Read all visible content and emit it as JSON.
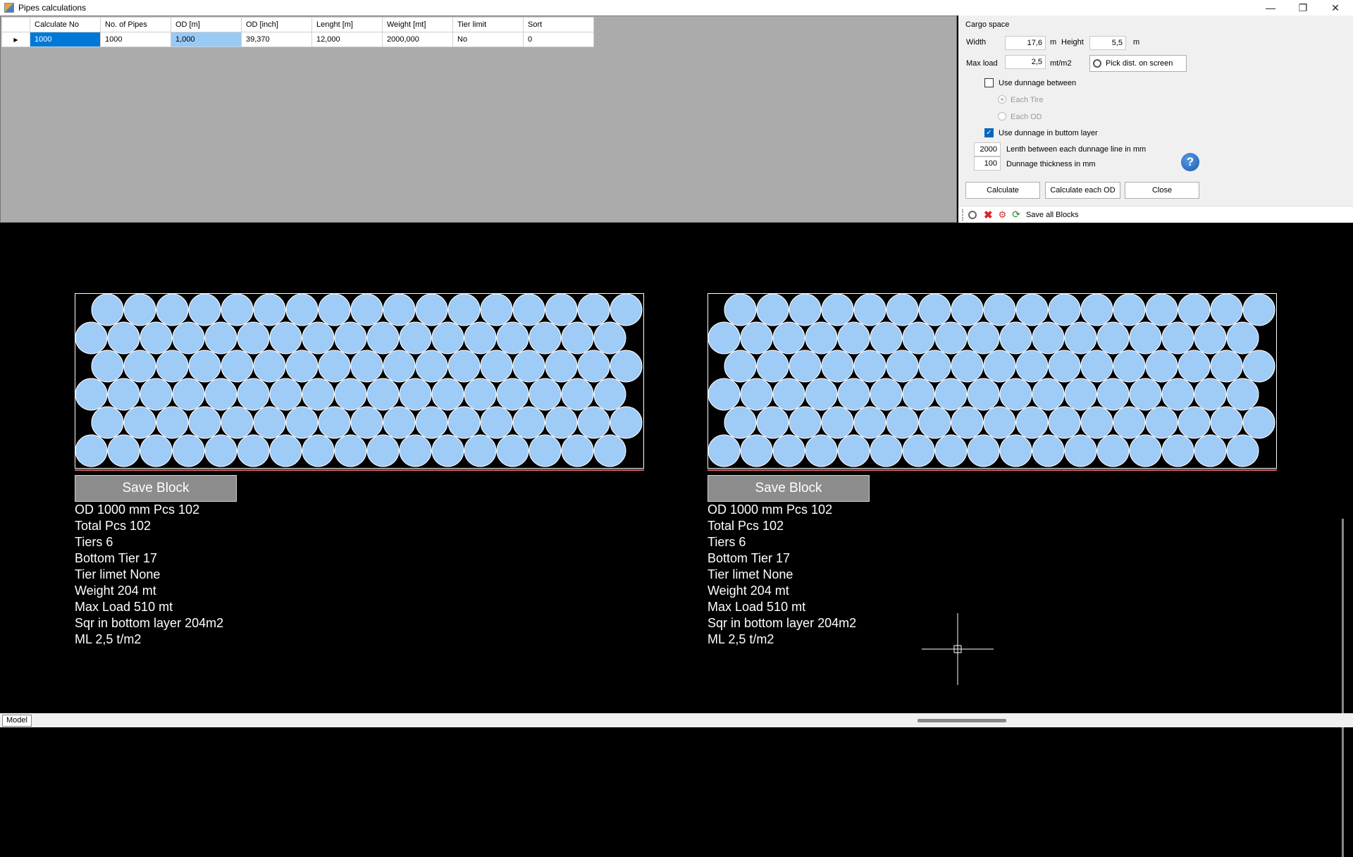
{
  "window": {
    "title": "Pipes calculations",
    "minimize": "—",
    "maximize": "❐",
    "close": "✕"
  },
  "grid": {
    "columns": [
      "Calculate No",
      "No. of Pipes",
      "OD [m]",
      "OD [inch]",
      "Lenght [m]",
      "Weight [mt]",
      "Tier limit",
      "Sort"
    ],
    "rows": [
      [
        "1000",
        "1000",
        "1,000",
        "39,370",
        "12,000",
        "2000,000",
        "No",
        "0"
      ]
    ]
  },
  "panel": {
    "group_title": "Cargo space",
    "width_label": "Width",
    "width_value": "17,6",
    "width_unit": "m",
    "height_label": "Height",
    "height_value": "5,5",
    "height_unit": "m",
    "maxload_label": "Max load",
    "maxload_value": "2,5",
    "maxload_unit": "mt/m2",
    "pick_button": "Pick dist. on screen",
    "use_dunnage_between": "Use dunnage between",
    "each_tire": "Each Tire",
    "each_od": "Each OD",
    "use_dunnage_bottom": "Use dunnage in buttom layer",
    "lenth_value": "2000",
    "lenth_label": "Lenth between each dunnage line in mm",
    "thickness_value": "100",
    "thickness_label": "Dunnage thickness in mm",
    "calculate": "Calculate",
    "calculate_each": "Calculate each OD",
    "close": "Close",
    "help": "?",
    "use_dunnage_between_checked": false,
    "use_dunnage_bottom_checked": true
  },
  "toolstrip": {
    "save_all": "Save all Blocks"
  },
  "blocks": [
    {
      "save_label": "Save Block",
      "lines": [
        "OD 1000 mm Pcs 102",
        "Total Pcs 102",
        "Tiers 6",
        "Bottom Tier 17",
        "Tier limet None",
        "Weight 204 mt",
        "Max Load 510 mt",
        "Sqr in bottom layer 204m2",
        "ML 2,5 t/m2"
      ]
    },
    {
      "save_label": "Save Block",
      "lines": [
        "OD 1000 mm Pcs 102",
        "Total Pcs 102",
        "Tiers 6",
        "Bottom Tier 17",
        "Tier limet None",
        "Weight 204 mt",
        "Max Load 510 mt",
        "Sqr in bottom layer 204m2",
        "ML 2,5 t/m2"
      ]
    }
  ],
  "statusbar": {
    "model_tab": "Model"
  },
  "colors": {
    "pipe_fill": "#9fcbf7",
    "pipe_stroke": "#ffffff",
    "frame": "#ffffff",
    "bottom_line": "#e0606a"
  }
}
